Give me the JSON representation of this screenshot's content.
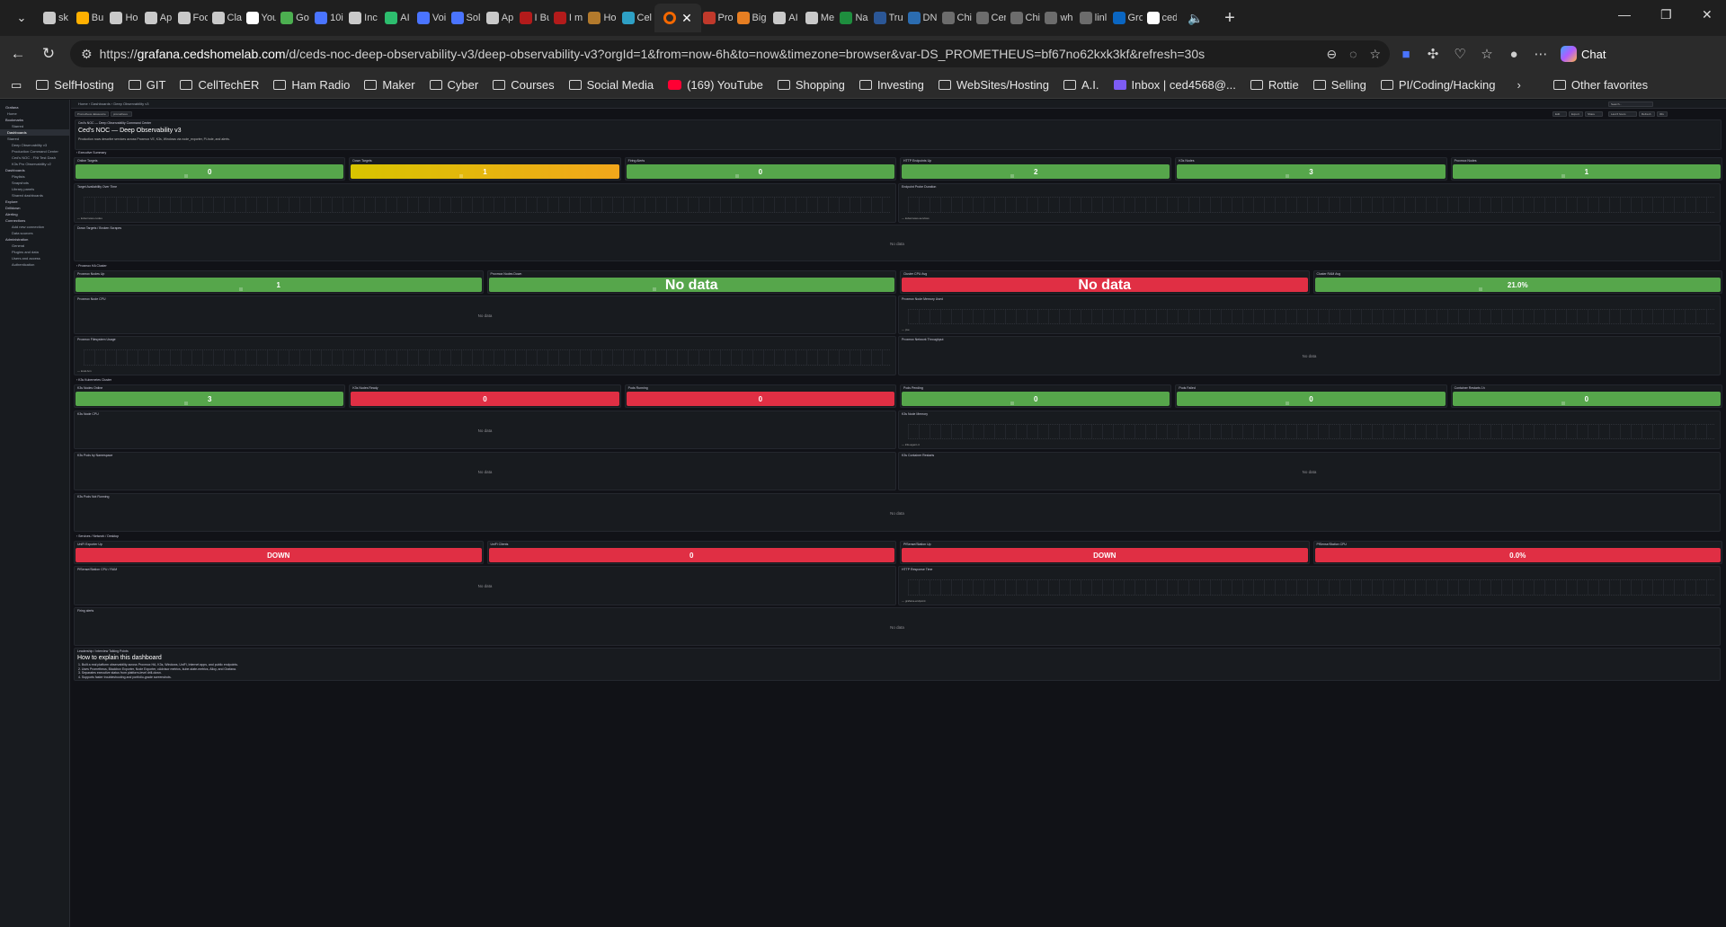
{
  "browser": {
    "tabs": [
      {
        "label": "sk",
        "color": "#c9c9c9"
      },
      {
        "label": "Bu",
        "color": "#ffb000"
      },
      {
        "label": "Ho",
        "color": "#c9c9c9"
      },
      {
        "label": "Ap",
        "color": "#c9c9c9"
      },
      {
        "label": "Foc",
        "color": "#c9c9c9"
      },
      {
        "label": "Cla",
        "color": "#c9c9c9"
      },
      {
        "label": "You",
        "color": "#ffffff"
      },
      {
        "label": "Go",
        "color": "#4caf50"
      },
      {
        "label": "10i",
        "color": "#4a74ff"
      },
      {
        "label": "Inc",
        "color": "#c9c9c9"
      },
      {
        "label": "AI",
        "color": "#2dbd6e"
      },
      {
        "label": "Voi",
        "color": "#4a74ff"
      },
      {
        "label": "Sol",
        "color": "#4a74ff"
      },
      {
        "label": "Ap",
        "color": "#c9c9c9"
      },
      {
        "label": "I Bu",
        "color": "#b31b1b"
      },
      {
        "label": "I m",
        "color": "#b31b1b"
      },
      {
        "label": "Ho",
        "color": "#b37a2c"
      },
      {
        "label": "Cel",
        "color": "#2ea0c5"
      }
    ],
    "active_tab": {
      "label": "Grafana",
      "color": "#f46800"
    },
    "tabs_right": [
      {
        "label": "Pro",
        "color": "#c0392b"
      },
      {
        "label": "Big",
        "color": "#e67e22"
      },
      {
        "label": "AI",
        "color": "#c9c9c9"
      },
      {
        "label": "Me",
        "color": "#c9c9c9"
      },
      {
        "label": "Na",
        "color": "#1e8e3e"
      },
      {
        "label": "Tru",
        "color": "#2b5797"
      },
      {
        "label": "DN",
        "color": "#2b6cb0"
      },
      {
        "label": "Chi",
        "color": "#6c6c6c"
      },
      {
        "label": "Cer",
        "color": "#6c6c6c"
      },
      {
        "label": "Chi",
        "color": "#6c6c6c"
      },
      {
        "label": "wh",
        "color": "#6c6c6c"
      },
      {
        "label": "linl",
        "color": "#6c6c6c"
      },
      {
        "label": "Gro",
        "color": "#0a66c2"
      },
      {
        "label": "ced",
        "color": "#ffffff"
      }
    ],
    "url_prefix": "https://",
    "url_host": "grafana.cedshomelab.com",
    "url_rest": "/d/ceds-noc-deep-observability-v3/deep-observability-v3?orgId=1&from=now-6h&to=now&timezone=browser&var-DS_PROMETHEUS=bf67no62kxk3kf&refresh=30s",
    "chat_label": "Chat",
    "bookmarks": [
      {
        "label": "SelfHosting",
        "type": "folder"
      },
      {
        "label": "GIT",
        "type": "folder"
      },
      {
        "label": "CellTechER",
        "type": "folder"
      },
      {
        "label": "Ham Radio",
        "type": "folder"
      },
      {
        "label": "Maker",
        "type": "folder"
      },
      {
        "label": "Cyber",
        "type": "folder"
      },
      {
        "label": "Courses",
        "type": "folder"
      },
      {
        "label": "Social Media",
        "type": "folder"
      },
      {
        "label": "(169) YouTube",
        "type": "youtube"
      },
      {
        "label": "Shopping",
        "type": "folder"
      },
      {
        "label": "Investing",
        "type": "folder"
      },
      {
        "label": "WebSites/Hosting",
        "type": "folder"
      },
      {
        "label": "A.I.",
        "type": "folder"
      },
      {
        "label": "Inbox | ced4568@...",
        "type": "mail"
      },
      {
        "label": "Rottie",
        "type": "folder"
      },
      {
        "label": "Selling",
        "type": "folder"
      },
      {
        "label": "PI/Coding/Hacking",
        "type": "folder"
      }
    ],
    "other_favorites": "Other favorites"
  },
  "grafana": {
    "breadcrumb": "Home › Dashboards › Deep Observability v3",
    "sidebar": [
      {
        "label": "Grafana",
        "cls": "h"
      },
      {
        "label": "Home",
        "cls": ""
      },
      {
        "label": "Bookmarks",
        "cls": "h"
      },
      {
        "label": "Starred",
        "cls": "sub"
      },
      {
        "label": "Dashboards",
        "cls": "act"
      },
      {
        "label": "Starred",
        "cls": ""
      },
      {
        "label": "Deep Observability v3",
        "cls": "sub"
      },
      {
        "label": "Production Command Center",
        "cls": "sub"
      },
      {
        "label": "Ced's NOC - FNt Test Dash",
        "cls": "sub"
      },
      {
        "label": "K3s Pro Observability v2",
        "cls": "sub"
      },
      {
        "label": "Dashboards",
        "cls": "h"
      },
      {
        "label": "Playlists",
        "cls": "sub"
      },
      {
        "label": "Snapshots",
        "cls": "sub"
      },
      {
        "label": "Library panels",
        "cls": "sub"
      },
      {
        "label": "Shared dashboards",
        "cls": "sub"
      },
      {
        "label": "Explore",
        "cls": "h"
      },
      {
        "label": "Drilldown",
        "cls": "h"
      },
      {
        "label": "Alerting",
        "cls": "h"
      },
      {
        "label": "Connections",
        "cls": "h"
      },
      {
        "label": "Add new connection",
        "cls": "sub"
      },
      {
        "label": "Data sources",
        "cls": "sub"
      },
      {
        "label": "Administration",
        "cls": "h"
      },
      {
        "label": "General",
        "cls": "sub"
      },
      {
        "label": "Plugins and data",
        "cls": "sub"
      },
      {
        "label": "Users and access",
        "cls": "sub"
      },
      {
        "label": "Authentication",
        "cls": "sub"
      }
    ],
    "variables": [
      "Prometheus datasource",
      "prometheus"
    ],
    "toolbar": [
      "Search...",
      "Edit",
      "Export",
      "Share",
      "Last 6 hours",
      "Refresh",
      "30s"
    ],
    "header_small": "Ced's NOC — Deep Observability Command Center",
    "title": "Ced's NOC — Deep Observability v3",
    "subtitle": "Production rows describe services across Proxmox VE, K3s, Windows via node_exporter, Pi-hole, and alerts.",
    "rows": {
      "r1": "› Executive Summary",
      "r2": "› Proxmox HA Cluster",
      "r3": "› K3s Kubernetes Cluster",
      "r4": "› Services / Network / Desktop"
    },
    "stats1": [
      {
        "title": "Online Targets",
        "value": "0"
      },
      {
        "title": "Down Targets",
        "value": "1"
      },
      {
        "title": "Firing Alerts",
        "value": "0"
      },
      {
        "title": "HTTP Endpoints Up",
        "value": "2"
      },
      {
        "title": "K3s Nodes",
        "value": "3"
      },
      {
        "title": "Proxmox Nodes",
        "value": "1"
      }
    ],
    "panels": {
      "target_avail": "Target Availability Over Time",
      "endpoint_probe": "Endpoint Probe Duration",
      "down_targets": "Down Targets / Broken Scrapes",
      "pve_cpu": "Proxmox Node CPU",
      "pve_mem": "Proxmox Node Memory Used",
      "pve_fs": "Proxmox Filesystem Usage",
      "pve_net": "Proxmox Network Throughput",
      "k3s_cpu": "K3s Node CPU",
      "k3s_mem": "K3s Node Memory",
      "k3s_pods_ns": "K3s Pods by Namespace",
      "k3s_restarts": "K3s Container Restarts",
      "k3s_not_running": "K3s Pods Not Running",
      "pf_cpu": "PfSense/Station CPU / RAM",
      "http_resp": "HTTP Response Time",
      "firing": "Firing alerts",
      "leadership": "Leadership / Interview Talking Points"
    },
    "stats2": [
      {
        "title": "Proxmox Nodes Up",
        "value": "1"
      },
      {
        "title": "Proxmox Nodes Down",
        "value": "No data"
      },
      {
        "title": "Cluster CPU Avg",
        "value": "No data"
      },
      {
        "title": "Cluster RAM Avg",
        "value": "21.0%"
      }
    ],
    "stats3": [
      {
        "title": "K3s Nodes Online",
        "value": "3"
      },
      {
        "title": "K3s Nodes Ready",
        "value": "0"
      },
      {
        "title": "Pods Running",
        "value": "0"
      },
      {
        "title": "Pods Pending",
        "value": "0"
      },
      {
        "title": "Pods Failed",
        "value": "0"
      },
      {
        "title": "Container Restarts 1h",
        "value": "0"
      }
    ],
    "stats4": [
      {
        "title": "UniFi Exporter Up",
        "value": "DOWN"
      },
      {
        "title": "UniFi Clients",
        "value": "0"
      },
      {
        "title": "PfSense/Station Up",
        "value": "DOWN"
      },
      {
        "title": "PfSense/Station CPU",
        "value": "0.0%"
      }
    ],
    "nodata": "No data",
    "legends": {
      "avail": "— kubernetes-nodes",
      "probe": "— kubernetes-services",
      "pve_mem": "— pve",
      "pve_fs": "— local-lvm",
      "k3s_mem": "— k3s-agent-4",
      "http": "— grafana-endpoint"
    },
    "info": {
      "title": "How to explain this dashboard",
      "lines": [
        "1. Built a real platform observability across Proxmox HA, K3s, Windows, UniFi, Internet apps, and public endpoints.",
        "2. Uses Prometheus, Blackbox Exporter, Node Exporter, cAdvisor metrics, kube-state-metrics, Alloy, and Grafana.",
        "3. Separates executive status from platform-level drill-down.",
        "4. Supports faster troubleshooting and portfolio-grade screenshots."
      ]
    }
  }
}
